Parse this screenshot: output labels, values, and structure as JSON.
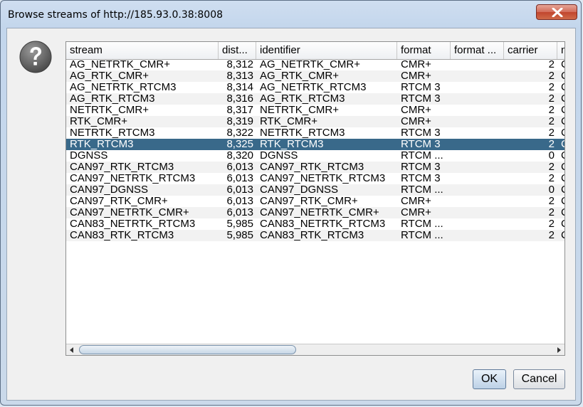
{
  "window": {
    "title": "Browse streams of http://185.93.0.38:8008"
  },
  "table": {
    "columns": [
      "stream",
      "dist...",
      "identifier",
      "format",
      "format ...",
      "carrier",
      "n"
    ],
    "rows": [
      [
        "AG_NETRTK_CMR+",
        "8,312",
        "AG_NETRTK_CMR+",
        "CMR+",
        "",
        "2",
        "C"
      ],
      [
        "AG_RTK_CMR+",
        "8,313",
        "AG_RTK_CMR+",
        "CMR+",
        "",
        "2",
        "C"
      ],
      [
        "AG_NETRTK_RTCM3",
        "8,314",
        "AG_NETRTK_RTCM3",
        "RTCM 3",
        "",
        "2",
        "C"
      ],
      [
        "AG_RTK_RTCM3",
        "8,316",
        "AG_RTK_RTCM3",
        "RTCM 3",
        "",
        "2",
        "C"
      ],
      [
        "NETRTK_CMR+",
        "8,317",
        "NETRTK_CMR+",
        "CMR+",
        "",
        "2",
        "C"
      ],
      [
        "RTK_CMR+",
        "8,319",
        "RTK_CMR+",
        "CMR+",
        "",
        "2",
        "C"
      ],
      [
        "NETRTK_RTCM3",
        "8,322",
        "NETRTK_RTCM3",
        "RTCM 3",
        "",
        "2",
        "C"
      ],
      [
        "RTK_RTCM3",
        "8,325",
        "RTK_RTCM3",
        "RTCM 3",
        "",
        "2",
        "C"
      ],
      [
        "DGNSS",
        "8,320",
        "DGNSS",
        "RTCM ...",
        "",
        "0",
        "C"
      ],
      [
        "CAN97_RTK_RTCM3",
        "6,013",
        "CAN97_RTK_RTCM3",
        "RTCM 3",
        "",
        "2",
        "C"
      ],
      [
        "CAN97_NETRTK_RTCM3",
        "6,013",
        "CAN97_NETRTK_RTCM3",
        "RTCM 3",
        "",
        "2",
        "C"
      ],
      [
        "CAN97_DGNSS",
        "6,013",
        "CAN97_DGNSS",
        "RTCM ...",
        "",
        "0",
        "C"
      ],
      [
        "CAN97_RTK_CMR+",
        "6,013",
        "CAN97_RTK_CMR+",
        "CMR+",
        "",
        "2",
        "C"
      ],
      [
        "CAN97_NETRTK_CMR+",
        "6,013",
        "CAN97_NETRTK_CMR+",
        "CMR+",
        "",
        "2",
        "C"
      ],
      [
        "CAN83_NETRTK_RTCM3",
        "5,985",
        "CAN83_NETRTK_RTCM3",
        "RTCM ...",
        "",
        "2",
        "C"
      ],
      [
        "CAN83_RTK_RTCM3",
        "5,985",
        "CAN83_RTK_RTCM3",
        "RTCM ...",
        "",
        "2",
        "C"
      ]
    ],
    "selected_row": 7
  },
  "buttons": {
    "ok": "OK",
    "cancel": "Cancel"
  },
  "colors": {
    "selection": "#39698a",
    "close_button": "#c1462e"
  },
  "icons": {
    "dialog": "question-icon",
    "close": "close-icon",
    "scroll_left": "arrow-left-icon",
    "scroll_right": "arrow-right-icon"
  }
}
